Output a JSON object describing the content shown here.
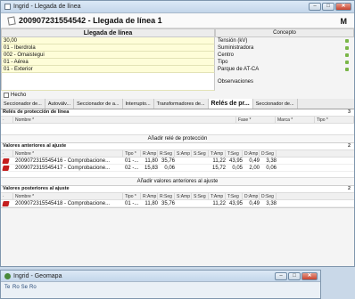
{
  "window": {
    "title": "Ingrid - Llegada de línea",
    "heading": "200907231554542 - Llegada de línea 1",
    "binoculars": "M"
  },
  "form": {
    "left_header": "Llegada de línea",
    "right_header": "Concepto",
    "rows": [
      {
        "value": "30,00",
        "label": "Tensión (kV)"
      },
      {
        "value": "01 - Iberdrola",
        "label": "Suministradora"
      },
      {
        "value": "002 - Omaistegui",
        "label": "Centro"
      },
      {
        "value": "01 - Aérea",
        "label": "Tipo"
      },
      {
        "value": "01 - Exterior",
        "label": "Parque de AT-CA"
      }
    ],
    "observaciones": "Observaciones",
    "hecho": "Hecho"
  },
  "tabs": [
    "Seccionador de...",
    "Autoválv...",
    "Seccionador de a...",
    "Interrupto...",
    "Transformadores de...",
    "Relés de pr...",
    "Seccionador de..."
  ],
  "reles": {
    "title": "Relés de protección de línea",
    "count": "3",
    "columns": [
      "·",
      "Nombre *",
      "Fase *",
      "Marca *",
      "Tipo *"
    ],
    "add": "Añadir relé de protección"
  },
  "anteriores": {
    "title": "Valores anteriores al ajuste",
    "count": "2",
    "columns": [
      "·",
      "Nombre *",
      "Tipo *",
      "R:Amp",
      "R:Seg",
      "S:Amp",
      "S:Seg",
      "T:Amp",
      "T:Seg",
      "D:Amp",
      "D:Seg"
    ],
    "rows": [
      [
        "2009072315545416 - Comprobacione...",
        "01 -...",
        "11,80",
        "35,76",
        "",
        "",
        "11,22",
        "43,95",
        "0,49",
        "3,38"
      ],
      [
        "2009072315545417 - Comprobacione...",
        "02 -...",
        "15,83",
        "0,06",
        "",
        "",
        "15,72",
        "0,05",
        "2,00",
        "0,06"
      ]
    ],
    "add": "Añadir valores anteriores al ajuste"
  },
  "posteriores": {
    "title": "Valores posteriores al ajuste",
    "count": "2",
    "columns": [
      "·",
      "Nombre *",
      "Tipo *",
      "R:Amp",
      "R:Seg",
      "S:Amp",
      "S:Seg",
      "T:Amp",
      "T:Seg",
      "D:Amp",
      "D:Seg"
    ],
    "rows": [
      [
        "2009072315545418 - Comprobacione...",
        "01 -...",
        "11,80",
        "35,76",
        "",
        "",
        "11,22",
        "43,95",
        "0,49",
        "3,38"
      ]
    ]
  },
  "window2": {
    "title": "Ingrid - Geomapa",
    "tools": [
      "Te",
      "Ro",
      "Se",
      "Ro"
    ]
  }
}
